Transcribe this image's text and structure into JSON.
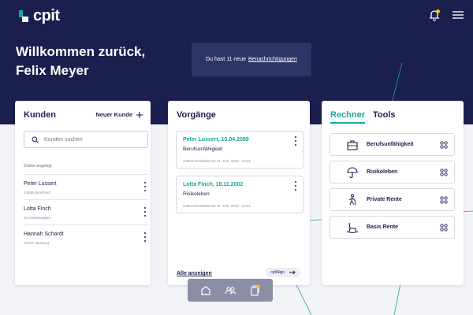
{
  "brand": {
    "logo_text": "cpit",
    "accent": "#1aa698",
    "navy": "#1b1f4e",
    "badge": "#f5c518"
  },
  "header": {
    "notification_icon": "bell-icon",
    "menu_icon": "hamburger-menu-icon"
  },
  "welcome": {
    "line1": "Willkommen zurück,",
    "line2": "Felix Meyer"
  },
  "notification": {
    "text": "Du hast 11 neue",
    "link": "Benachrichtigungen"
  },
  "kunden": {
    "title": "Kunden",
    "new_label": "Neuer Kunde",
    "search_placeholder": "Kunden suchen",
    "section_label": "Zuletzt angelegt",
    "items": [
      {
        "name": "Peter Lussert",
        "sub": "43889 Burscheid"
      },
      {
        "name": "Lotta Finch",
        "sub": "42 Hückeswagen"
      },
      {
        "name": "Hannah Schardt",
        "sub": "22767 Hamburg"
      }
    ]
  },
  "vorgaenge": {
    "title": "Vorgänge",
    "items": [
      {
        "title": "Peter Lussert, 15.04.2089",
        "sub": "Berufsunfähigkeit",
        "date": "zuletzt bearbeitet am 21. Feb. 2023 - 13:21"
      },
      {
        "title": "Lotta Finch, 18.11.2002",
        "sub": "Risikoleben",
        "date": "zuletzt bearbeitet am 21. Feb. 2023 - 13:21"
      }
    ],
    "show_all": "Alle anzeigen",
    "sign_label": "cpitSign"
  },
  "rechner": {
    "tabs": [
      {
        "label": "Rechner"
      },
      {
        "label": "Tools"
      }
    ],
    "items": [
      {
        "label": "Berufsunfähigkeit",
        "icon": "briefcase-icon"
      },
      {
        "label": "Risikoleben",
        "icon": "umbrella-icon"
      },
      {
        "label": "Private Rente",
        "icon": "walking-person-icon"
      },
      {
        "label": "Basis Rente",
        "icon": "rocking-chair-icon"
      }
    ]
  },
  "bottom_nav": [
    {
      "icon": "home-icon"
    },
    {
      "icon": "people-icon"
    },
    {
      "icon": "documents-icon"
    }
  ]
}
